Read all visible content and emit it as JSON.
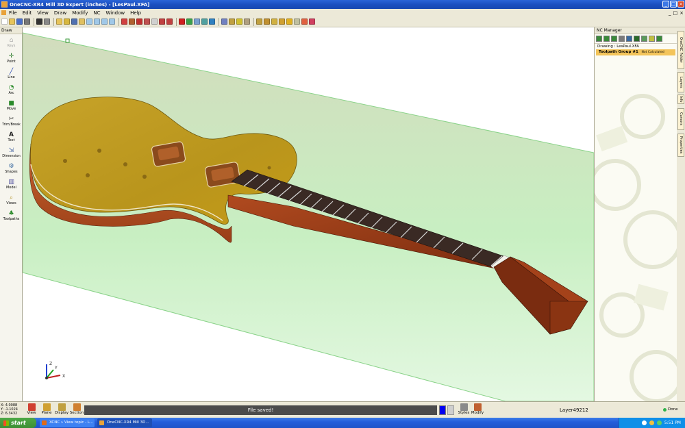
{
  "window": {
    "title": "OneCNC-XR4 Mill 3D Expert (inches) - [LesPaul.XFA]",
    "controls": [
      "_",
      "□",
      "×"
    ]
  },
  "menu": {
    "items": [
      "File",
      "Edit",
      "View",
      "Draw",
      "Modify",
      "NC",
      "Window",
      "Help"
    ],
    "mdi_controls": [
      "_",
      "□",
      "×"
    ]
  },
  "left_panel": {
    "title": "Draw",
    "tools": [
      {
        "label": "Keys",
        "icon": "home-icon",
        "disabled": true
      },
      {
        "label": "Point",
        "icon": "point-icon"
      },
      {
        "label": "Line",
        "icon": "line-icon"
      },
      {
        "label": "Arc",
        "icon": "arc-icon"
      },
      {
        "label": "Move",
        "icon": "move-icon"
      },
      {
        "label": "Trim/Break",
        "icon": "trim-icon"
      },
      {
        "label": "Text",
        "icon": "text-icon"
      },
      {
        "label": "Dimension",
        "icon": "dimension-icon"
      },
      {
        "label": "Shapes",
        "icon": "shapes-icon"
      },
      {
        "label": "Model",
        "icon": "model-icon"
      },
      {
        "label": "Views",
        "icon": "views-icon"
      },
      {
        "label": "Toolpaths",
        "icon": "toolpaths-icon"
      }
    ]
  },
  "right_panel": {
    "title": "NC Manager",
    "drawing_line": "Drawing : LesPaul.XFA",
    "group_name": "Toolpath Group #1",
    "group_note": "Not Calculated"
  },
  "vertical_tabs": [
    "OneCNC Folder",
    "Layers",
    "Info",
    "Cursors",
    "Properties"
  ],
  "viewport": {
    "axes": {
      "x": "X",
      "y": "Y",
      "z": "Z"
    }
  },
  "status": {
    "coords": [
      "X: 4.0088",
      "Y: -1.1024",
      "Z: 6.3432"
    ],
    "bottom_buttons": [
      "View",
      "Plane",
      "Display",
      "Section"
    ],
    "right_buttons": [
      "Styles",
      "Modify"
    ],
    "message": "File saved!",
    "layer": "Layer49212",
    "done": "Done"
  },
  "taskbar": {
    "start": "start",
    "items": [
      "XCNC » View topic - L...",
      "OneCNC-XR4 Mill 3D..."
    ],
    "clock": "5:51 PM"
  },
  "colors": {
    "accent_blue": "#245edb",
    "plane_green": "#c9f0c4",
    "body_top": "#c9a21e",
    "body_side": "#b5542a",
    "message_bar": "#4b4b4b",
    "active_color": "#0000f0"
  }
}
